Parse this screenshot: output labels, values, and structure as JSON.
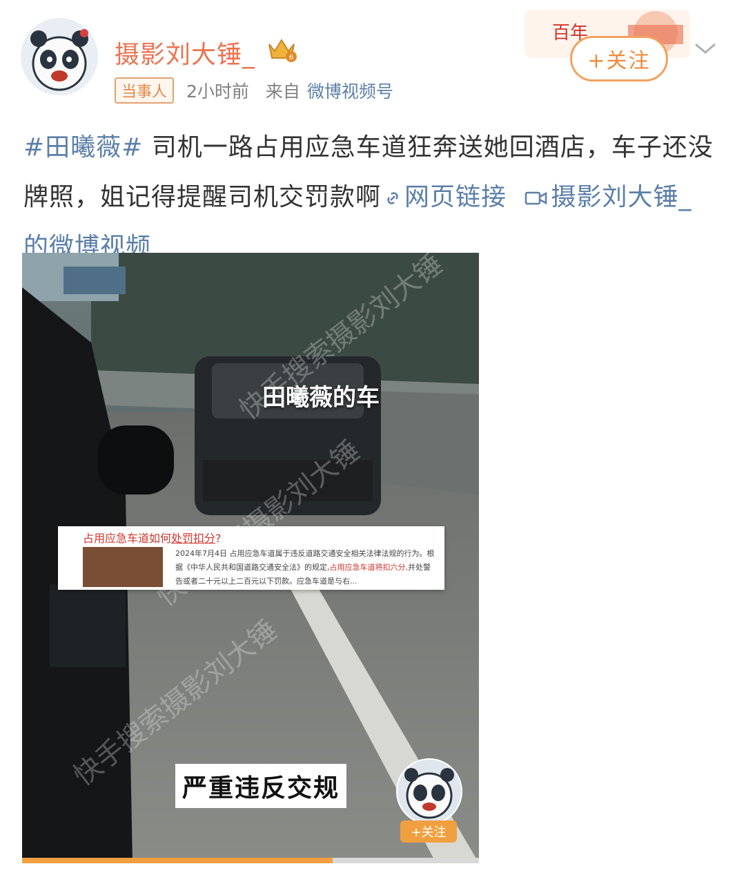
{
  "header": {
    "username": "摄影刘大锤_",
    "tag": "当事人",
    "time": "2小时前",
    "source_label": "来自",
    "source": "微博视频号",
    "follow_label": "+关注",
    "banner_text": "百年"
  },
  "post": {
    "hashtag": "#田曦薇#",
    "text": " 司机一路占用应急车道狂奔送她回酒店，车子还没牌照，姐记得提醒司机交罚款啊",
    "link_label": "网页链接",
    "video_link_label": "摄影刘大锤_的微博视频"
  },
  "video": {
    "car_label": "田曦薇的车",
    "news": {
      "headline_pre": "占用应急车道如何",
      "headline_u": "处罚扣分",
      "headline_post": "?",
      "body_pre": "2024年7月4日 占用应急车道属于违反道路交通安全相关法律法规的行为。根据《中华人民共和国道路交通安全法》的规定,",
      "body_red": "占用应急车道将扣六分,",
      "body_post": "并处警告或者二十元以上二百元以下罚款。应急车道是与右..."
    },
    "caption": "严重违反交规",
    "follow_label": "+关注",
    "watermark": "快手搜索摄影刘大锤",
    "progress": 0.68
  },
  "colors": {
    "accent_orange": "#eb7350",
    "link_blue": "#5b7fa8",
    "follow_orange": "#f0a040"
  }
}
